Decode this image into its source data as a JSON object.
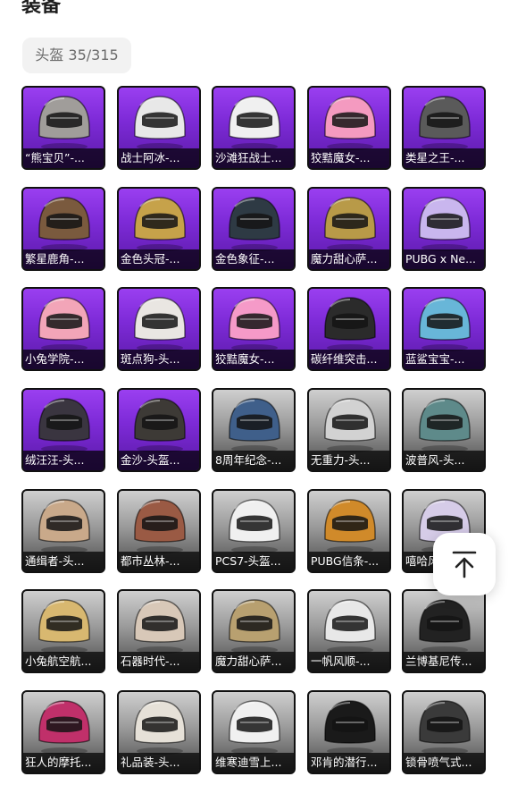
{
  "header": {
    "title": "装备"
  },
  "filter": {
    "label": "头盔 35/315"
  },
  "items": [
    {
      "label": "“熊宝贝”-...",
      "bg": "purple",
      "color": "#a09d9a"
    },
    {
      "label": "战士阿冰-...",
      "bg": "purple",
      "color": "#e8e8e8"
    },
    {
      "label": "沙滩狂战士...",
      "bg": "purple",
      "color": "#f0f0f0"
    },
    {
      "label": "狡黠魔女-...",
      "bg": "purple",
      "color": "#f49ac0"
    },
    {
      "label": "类星之王-...",
      "bg": "purple",
      "color": "#5a5a5a"
    },
    {
      "label": "繁星鹿角-...",
      "bg": "purple",
      "color": "#7a5a3e"
    },
    {
      "label": "金色头冠-...",
      "bg": "purple",
      "color": "#c6a24a"
    },
    {
      "label": "金色象征-...",
      "bg": "purple",
      "color": "#2e3a44"
    },
    {
      "label": "魔力甜心萨...",
      "bg": "purple",
      "color": "#b89a48"
    },
    {
      "label": "PUBG x Ne...",
      "bg": "purple",
      "color": "#c9b6ee"
    },
    {
      "label": "小兔学院-...",
      "bg": "purple",
      "color": "#f2a5b8"
    },
    {
      "label": "斑点狗-头...",
      "bg": "purple",
      "color": "#e9e6e2"
    },
    {
      "label": "狡黠魔女-...",
      "bg": "purple",
      "color": "#f59ac8"
    },
    {
      "label": "碳纤维突击...",
      "bg": "purple",
      "color": "#2b2b2b"
    },
    {
      "label": "蓝鲨宝宝-...",
      "bg": "purple",
      "color": "#68b6d8"
    },
    {
      "label": "绒汪汪-头...",
      "bg": "purple",
      "color": "#3a3540"
    },
    {
      "label": "金沙-头盔...",
      "bg": "purple",
      "color": "#3d3a36"
    },
    {
      "label": "8周年纪念-...",
      "bg": "gray",
      "color": "#3f5f8a"
    },
    {
      "label": "无重力-头...",
      "bg": "gray",
      "color": "#d2d2d2"
    },
    {
      "label": "波普风-头...",
      "bg": "gray",
      "color": "#5e8a8a"
    },
    {
      "label": "通缉者-头...",
      "bg": "gray",
      "color": "#c9a98a"
    },
    {
      "label": "都市丛林-...",
      "bg": "gray",
      "color": "#9a5a44"
    },
    {
      "label": "PCS7-头盔...",
      "bg": "gray",
      "color": "#f0f0f0"
    },
    {
      "label": "PUBG信条-...",
      "bg": "gray",
      "color": "#d08a2a"
    },
    {
      "label": "嘻哈风-...",
      "bg": "gray",
      "color": "#d6cce8"
    },
    {
      "label": "小兔航空航...",
      "bg": "gray",
      "color": "#d8b870"
    },
    {
      "label": "石器时代-...",
      "bg": "gray",
      "color": "#d8c8b8"
    },
    {
      "label": "魔力甜心萨...",
      "bg": "gray",
      "color": "#b8a070"
    },
    {
      "label": "一帆风顺-...",
      "bg": "gray",
      "color": "#e8e8e8"
    },
    {
      "label": "兰博基尼传...",
      "bg": "gray",
      "color": "#222222"
    },
    {
      "label": "狂人的摩托...",
      "bg": "gray",
      "color": "#c0306a"
    },
    {
      "label": "礼品装-头...",
      "bg": "gray",
      "color": "#e6e1d8"
    },
    {
      "label": "维寒迪雪上...",
      "bg": "gray",
      "color": "#f0f0f0"
    },
    {
      "label": "邓肯的潜行...",
      "bg": "gray",
      "color": "#1a1a1a"
    },
    {
      "label": "锁骨喷气式...",
      "bg": "gray",
      "color": "#3a3a3a"
    }
  ],
  "back_to_top": {
    "icon": "arrow-up-to-line-icon"
  }
}
